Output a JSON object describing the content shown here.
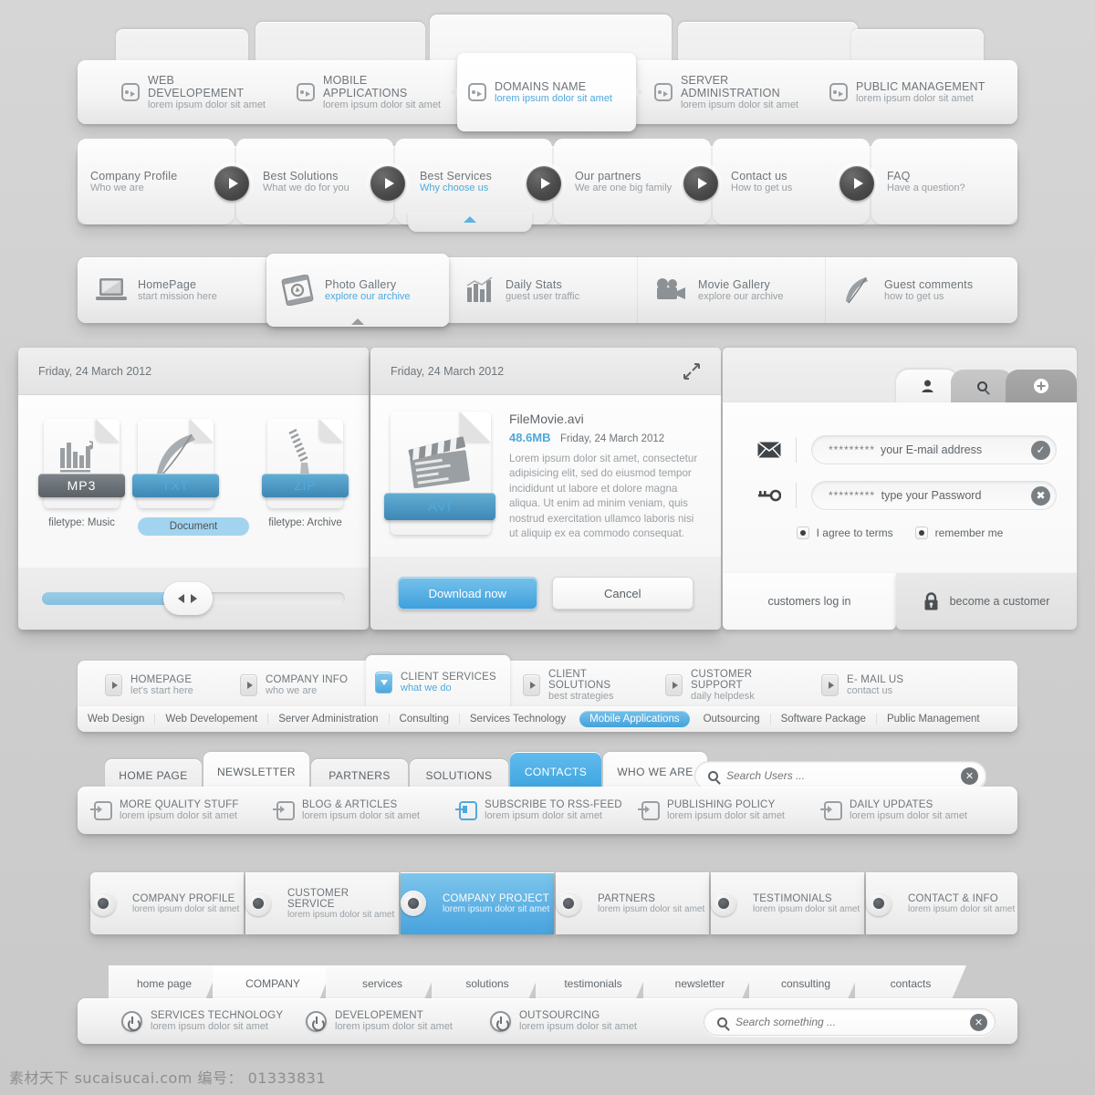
{
  "colors": {
    "accent": "#4fa8dd",
    "accent_dark": "#3ba3de",
    "text": "#6f757a",
    "muted": "#9aa0a5"
  },
  "row1": {
    "items": [
      {
        "title": "WEB DEVELOPEMENT",
        "sub": "lorem ipsum dolor sit amet",
        "active": false
      },
      {
        "title": "MOBILE APPLICATIONS",
        "sub": "lorem ipsum dolor sit amet",
        "active": false
      },
      {
        "title": "DOMAINS NAME",
        "sub": "lorem ipsum dolor sit amet",
        "active": true
      },
      {
        "title": "SERVER ADMINISTRATION",
        "sub": "lorem ipsum dolor sit amet",
        "active": false
      },
      {
        "title": "PUBLIC MANAGEMENT",
        "sub": "lorem ipsum dolor sit amet",
        "active": false
      }
    ]
  },
  "row2": {
    "items": [
      {
        "title": "Company Profile",
        "sub": "Who we are",
        "active": false
      },
      {
        "title": "Best Solutions",
        "sub": "What we do for you",
        "active": false
      },
      {
        "title": "Best Services",
        "sub": "Why choose us",
        "active": true
      },
      {
        "title": "Our partners",
        "sub": "We are one big family",
        "active": false
      },
      {
        "title": "Contact us",
        "sub": "How to get us",
        "active": false
      },
      {
        "title": "FAQ",
        "sub": "Have a question?",
        "active": false
      }
    ]
  },
  "row3": {
    "items": [
      {
        "title": "HomePage",
        "sub": "start mission here",
        "icon": "laptop-icon",
        "active": false
      },
      {
        "title": "Photo Gallery",
        "sub": "explore our archive",
        "icon": "film-icon",
        "active": true
      },
      {
        "title": "Daily Stats",
        "sub": "guest user traffic",
        "icon": "bar-chart-icon",
        "active": false
      },
      {
        "title": "Movie Gallery",
        "sub": "explore our archive",
        "icon": "movie-camera-icon",
        "active": false
      },
      {
        "title": "Guest comments",
        "sub": "how to get us",
        "icon": "feather-icon",
        "active": false
      }
    ]
  },
  "filecard": {
    "date": "Friday, 24 March 2012",
    "files": [
      {
        "ext": "MP3",
        "caption": "filetype: Music",
        "tagstyle": "gray",
        "selected": false,
        "icon": "audio-bars-icon"
      },
      {
        "ext": "TXT",
        "caption": "Document",
        "tagstyle": "blue",
        "selected": true,
        "icon": "feather-icon"
      },
      {
        "ext": "ZIP",
        "caption": "filetype: Archive",
        "tagstyle": "blue",
        "selected": false,
        "icon": "zipper-icon"
      }
    ],
    "slider_percent": 44
  },
  "downloadcard": {
    "date": "Friday, 24 March 2012",
    "expand_icon": "expand-arrows-icon",
    "file_ext": "AVI",
    "file_icon": "clapperboard-icon",
    "file_name": "FileMovie.avi",
    "file_size": "48.6MB",
    "file_date": "Friday, 24 March 2012",
    "description": "Lorem ipsum dolor sit amet, consectetur adipisicing elit, sed do eiusmod tempor incididunt ut labore et dolore magna aliqua. Ut enim ad minim veniam, quis nostrud exercitation ullamco laboris nisi ut aliquip ex ea commodo consequat.",
    "primary_button": "Download now",
    "secondary_button": "Cancel"
  },
  "login": {
    "tabs": [
      {
        "icon": "user-icon",
        "state": "active"
      },
      {
        "icon": "search-icon",
        "state": "inactive"
      },
      {
        "icon": "plus-circle-icon",
        "state": "inactive-dark"
      }
    ],
    "email": {
      "icon": "envelope-icon",
      "masked": "*********",
      "placeholder": "your E-mail address",
      "badge": "✓"
    },
    "password": {
      "icon": "key-icon",
      "masked": "*********",
      "placeholder": "type your Password",
      "badge": "✖"
    },
    "checkbox_terms": "I agree to terms",
    "checkbox_remember": "remember me",
    "tab_login": "customers log in",
    "tab_register": "become a customer",
    "lock_icon": "lock-icon"
  },
  "row5": {
    "items": [
      {
        "title": "HOMEPAGE",
        "sub": "let's start here",
        "active": false
      },
      {
        "title": "COMPANY INFO",
        "sub": "who we are",
        "active": false
      },
      {
        "title": "CLIENT SERVICES",
        "sub": "what we do",
        "active": true
      },
      {
        "title": "CLIENT SOLUTIONS",
        "sub": "best strategies",
        "active": false
      },
      {
        "title": "CUSTOMER SUPPORT",
        "sub": "daily helpdesk",
        "active": false
      },
      {
        "title": "E- MAIL US",
        "sub": "contact us",
        "active": false
      }
    ],
    "subnav": [
      {
        "label": "Web Design",
        "active": false
      },
      {
        "label": "Web Developement",
        "active": false
      },
      {
        "label": "Server  Administration",
        "active": false
      },
      {
        "label": "Consulting",
        "active": false
      },
      {
        "label": "Services Technology",
        "active": false
      },
      {
        "label": "Mobile Applications",
        "active": true
      },
      {
        "label": "Outsourcing",
        "active": false
      },
      {
        "label": "Software Package",
        "active": false
      },
      {
        "label": "Public Management",
        "active": false
      }
    ]
  },
  "row6": {
    "tabs": [
      {
        "label": "HOME PAGE",
        "state": "normal"
      },
      {
        "label": "NEWSLETTER",
        "state": "up"
      },
      {
        "label": "PARTNERS",
        "state": "normal"
      },
      {
        "label": "SOLUTIONS",
        "state": "normal"
      },
      {
        "label": "CONTACTS",
        "state": "on"
      },
      {
        "label": "WHO WE ARE",
        "state": "up"
      }
    ],
    "search": {
      "placeholder": "Search Users ...",
      "icon": "search-icon",
      "clear_icon": "clear-icon"
    },
    "items": [
      {
        "title": "MORE QUALITY STUFF",
        "sub": "lorem ipsum dolor sit amet",
        "active": false
      },
      {
        "title": "BLOG & ARTICLES",
        "sub": "lorem ipsum dolor sit amet",
        "active": false
      },
      {
        "title": "SUBSCRIBE TO RSS-FEED",
        "sub": "lorem ipsum dolor sit amet",
        "active": true
      },
      {
        "title": "PUBLISHING POLICY",
        "sub": "lorem ipsum dolor sit amet",
        "active": false
      },
      {
        "title": "DAILY UPDATES",
        "sub": "lorem ipsum dolor sit amet",
        "active": false
      }
    ]
  },
  "row7": {
    "items": [
      {
        "title": "COMPANY PROFILE",
        "sub": "lorem ipsum dolor sit amet",
        "active": false
      },
      {
        "title": "CUSTOMER SERVICE",
        "sub": "lorem ipsum dolor sit amet",
        "active": false
      },
      {
        "title": "COMPANY PROJECT",
        "sub": "lorem ipsum dolor sit amet",
        "active": true
      },
      {
        "title": "PARTNERS",
        "sub": "lorem ipsum dolor sit amet",
        "active": false
      },
      {
        "title": "TESTIMONIALS",
        "sub": "lorem ipsum dolor sit amet",
        "active": false
      },
      {
        "title": "CONTACT & INFO",
        "sub": "lorem ipsum dolor sit amet",
        "active": false
      }
    ]
  },
  "row8": {
    "tabs": [
      {
        "label": "home page"
      },
      {
        "label": "COMPANY"
      },
      {
        "label": "services"
      },
      {
        "label": "solutions"
      },
      {
        "label": "testimonials"
      },
      {
        "label": "newsletter"
      },
      {
        "label": "consulting"
      },
      {
        "label": "contacts"
      }
    ],
    "items": [
      {
        "title": "SERVICES TECHNOLOGY",
        "sub": "lorem ipsum dolor sit amet"
      },
      {
        "title": "DEVELOPEMENT",
        "sub": "lorem ipsum dolor sit amet"
      },
      {
        "title": "OUTSOURCING",
        "sub": "lorem ipsum dolor sit amet"
      }
    ],
    "search": {
      "placeholder": "Search something ...",
      "icon": "search-icon",
      "clear_icon": "clear-icon"
    }
  },
  "watermark": "素材天下 sucaisucai.com  编号： 01333831"
}
